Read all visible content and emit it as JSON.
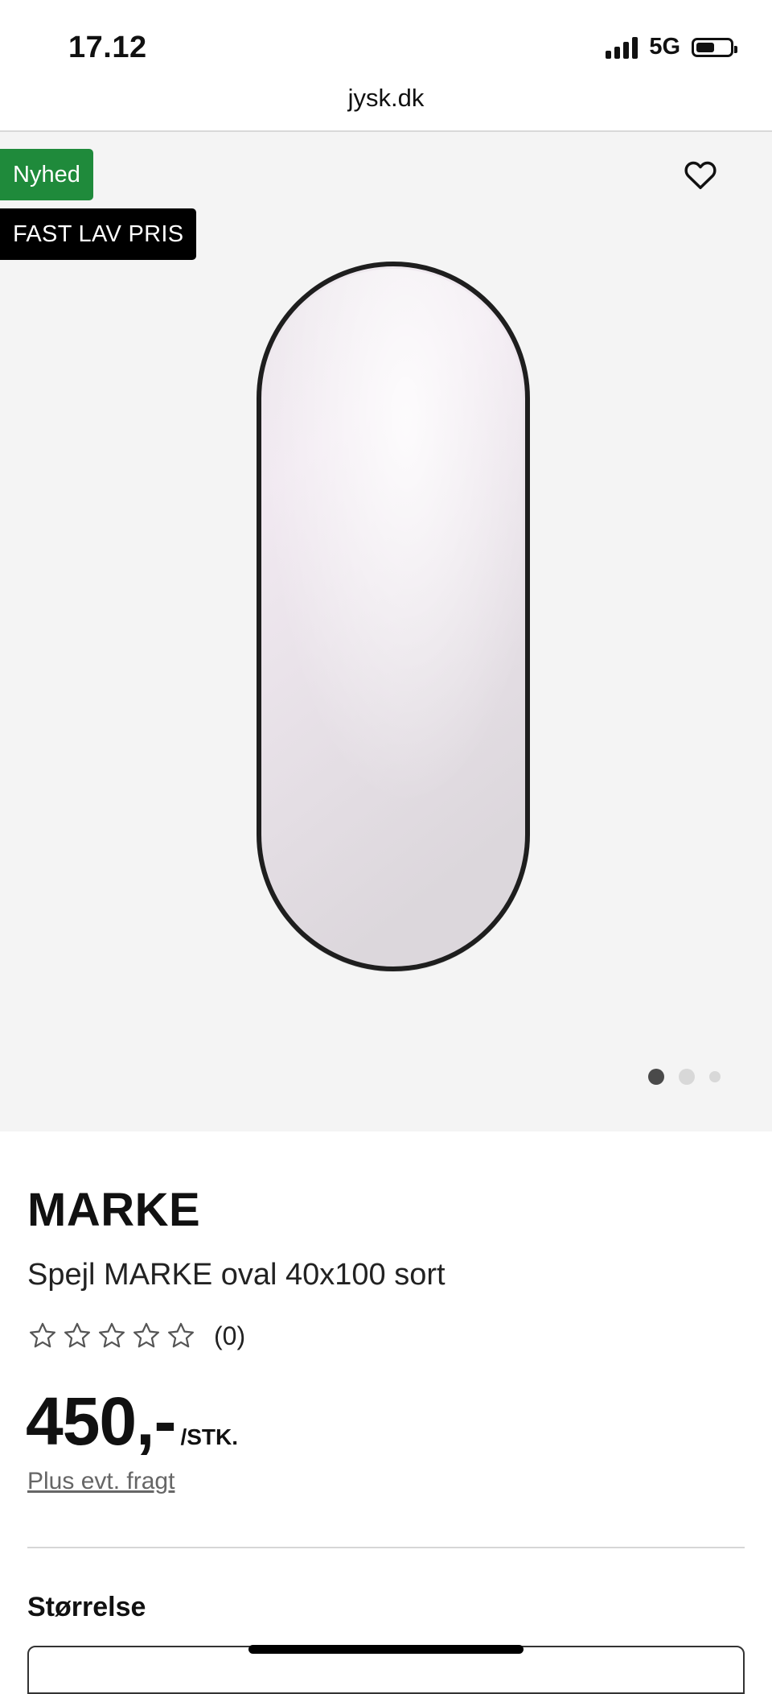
{
  "status_bar": {
    "time": "17.12",
    "network": "5G"
  },
  "browser": {
    "url": "jysk.dk"
  },
  "gallery": {
    "badges": {
      "new": "Nyhed",
      "price": "FAST LAV PRIS"
    },
    "current_image": 1,
    "image_count": 3
  },
  "product": {
    "brand": "MARKE",
    "name": "Spejl MARKE oval 40x100 sort",
    "rating": {
      "stars": 0,
      "max": 5,
      "count": "(0)"
    },
    "price": "450,-",
    "price_unit": "/STK.",
    "freight_link": "Plus evt. fragt",
    "size_heading": "Størrelse"
  },
  "colors": {
    "new_badge": "#1f8a3b",
    "price_badge": "#000000",
    "image_bg": "#f4f4f4"
  }
}
